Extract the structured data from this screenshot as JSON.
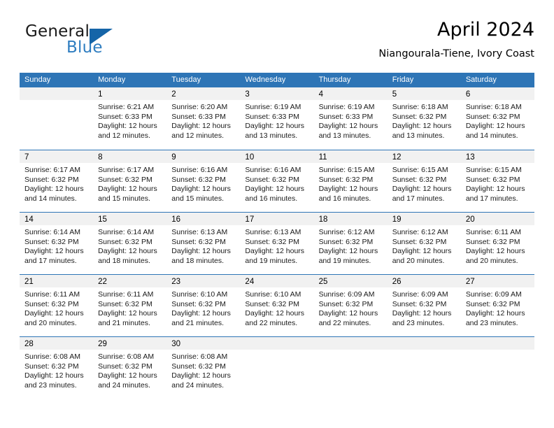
{
  "logo": {
    "word1": "General",
    "word2": "Blue",
    "triangle_icon": "blue-triangle-icon",
    "blue": "#2e7dc0",
    "triangle_color": "#1565a8"
  },
  "header": {
    "title": "April 2024",
    "subtitle": "Niangourala-Tiene, Ivory Coast"
  },
  "colors": {
    "header_blue": "#2e75b6",
    "week_divider": "#2e75b6",
    "daynum_band": "#f1f1f1",
    "text": "#000000"
  },
  "weekdays": [
    "Sunday",
    "Monday",
    "Tuesday",
    "Wednesday",
    "Thursday",
    "Friday",
    "Saturday"
  ],
  "weeks": [
    [
      {
        "day": ""
      },
      {
        "day": "1",
        "sunrise": "Sunrise: 6:21 AM",
        "sunset": "Sunset: 6:33 PM",
        "daylight1": "Daylight: 12 hours",
        "daylight2": "and 12 minutes."
      },
      {
        "day": "2",
        "sunrise": "Sunrise: 6:20 AM",
        "sunset": "Sunset: 6:33 PM",
        "daylight1": "Daylight: 12 hours",
        "daylight2": "and 12 minutes."
      },
      {
        "day": "3",
        "sunrise": "Sunrise: 6:19 AM",
        "sunset": "Sunset: 6:33 PM",
        "daylight1": "Daylight: 12 hours",
        "daylight2": "and 13 minutes."
      },
      {
        "day": "4",
        "sunrise": "Sunrise: 6:19 AM",
        "sunset": "Sunset: 6:33 PM",
        "daylight1": "Daylight: 12 hours",
        "daylight2": "and 13 minutes."
      },
      {
        "day": "5",
        "sunrise": "Sunrise: 6:18 AM",
        "sunset": "Sunset: 6:32 PM",
        "daylight1": "Daylight: 12 hours",
        "daylight2": "and 13 minutes."
      },
      {
        "day": "6",
        "sunrise": "Sunrise: 6:18 AM",
        "sunset": "Sunset: 6:32 PM",
        "daylight1": "Daylight: 12 hours",
        "daylight2": "and 14 minutes."
      }
    ],
    [
      {
        "day": "7",
        "sunrise": "Sunrise: 6:17 AM",
        "sunset": "Sunset: 6:32 PM",
        "daylight1": "Daylight: 12 hours",
        "daylight2": "and 14 minutes."
      },
      {
        "day": "8",
        "sunrise": "Sunrise: 6:17 AM",
        "sunset": "Sunset: 6:32 PM",
        "daylight1": "Daylight: 12 hours",
        "daylight2": "and 15 minutes."
      },
      {
        "day": "9",
        "sunrise": "Sunrise: 6:16 AM",
        "sunset": "Sunset: 6:32 PM",
        "daylight1": "Daylight: 12 hours",
        "daylight2": "and 15 minutes."
      },
      {
        "day": "10",
        "sunrise": "Sunrise: 6:16 AM",
        "sunset": "Sunset: 6:32 PM",
        "daylight1": "Daylight: 12 hours",
        "daylight2": "and 16 minutes."
      },
      {
        "day": "11",
        "sunrise": "Sunrise: 6:15 AM",
        "sunset": "Sunset: 6:32 PM",
        "daylight1": "Daylight: 12 hours",
        "daylight2": "and 16 minutes."
      },
      {
        "day": "12",
        "sunrise": "Sunrise: 6:15 AM",
        "sunset": "Sunset: 6:32 PM",
        "daylight1": "Daylight: 12 hours",
        "daylight2": "and 17 minutes."
      },
      {
        "day": "13",
        "sunrise": "Sunrise: 6:15 AM",
        "sunset": "Sunset: 6:32 PM",
        "daylight1": "Daylight: 12 hours",
        "daylight2": "and 17 minutes."
      }
    ],
    [
      {
        "day": "14",
        "sunrise": "Sunrise: 6:14 AM",
        "sunset": "Sunset: 6:32 PM",
        "daylight1": "Daylight: 12 hours",
        "daylight2": "and 17 minutes."
      },
      {
        "day": "15",
        "sunrise": "Sunrise: 6:14 AM",
        "sunset": "Sunset: 6:32 PM",
        "daylight1": "Daylight: 12 hours",
        "daylight2": "and 18 minutes."
      },
      {
        "day": "16",
        "sunrise": "Sunrise: 6:13 AM",
        "sunset": "Sunset: 6:32 PM",
        "daylight1": "Daylight: 12 hours",
        "daylight2": "and 18 minutes."
      },
      {
        "day": "17",
        "sunrise": "Sunrise: 6:13 AM",
        "sunset": "Sunset: 6:32 PM",
        "daylight1": "Daylight: 12 hours",
        "daylight2": "and 19 minutes."
      },
      {
        "day": "18",
        "sunrise": "Sunrise: 6:12 AM",
        "sunset": "Sunset: 6:32 PM",
        "daylight1": "Daylight: 12 hours",
        "daylight2": "and 19 minutes."
      },
      {
        "day": "19",
        "sunrise": "Sunrise: 6:12 AM",
        "sunset": "Sunset: 6:32 PM",
        "daylight1": "Daylight: 12 hours",
        "daylight2": "and 20 minutes."
      },
      {
        "day": "20",
        "sunrise": "Sunrise: 6:11 AM",
        "sunset": "Sunset: 6:32 PM",
        "daylight1": "Daylight: 12 hours",
        "daylight2": "and 20 minutes."
      }
    ],
    [
      {
        "day": "21",
        "sunrise": "Sunrise: 6:11 AM",
        "sunset": "Sunset: 6:32 PM",
        "daylight1": "Daylight: 12 hours",
        "daylight2": "and 20 minutes."
      },
      {
        "day": "22",
        "sunrise": "Sunrise: 6:11 AM",
        "sunset": "Sunset: 6:32 PM",
        "daylight1": "Daylight: 12 hours",
        "daylight2": "and 21 minutes."
      },
      {
        "day": "23",
        "sunrise": "Sunrise: 6:10 AM",
        "sunset": "Sunset: 6:32 PM",
        "daylight1": "Daylight: 12 hours",
        "daylight2": "and 21 minutes."
      },
      {
        "day": "24",
        "sunrise": "Sunrise: 6:10 AM",
        "sunset": "Sunset: 6:32 PM",
        "daylight1": "Daylight: 12 hours",
        "daylight2": "and 22 minutes."
      },
      {
        "day": "25",
        "sunrise": "Sunrise: 6:09 AM",
        "sunset": "Sunset: 6:32 PM",
        "daylight1": "Daylight: 12 hours",
        "daylight2": "and 22 minutes."
      },
      {
        "day": "26",
        "sunrise": "Sunrise: 6:09 AM",
        "sunset": "Sunset: 6:32 PM",
        "daylight1": "Daylight: 12 hours",
        "daylight2": "and 23 minutes."
      },
      {
        "day": "27",
        "sunrise": "Sunrise: 6:09 AM",
        "sunset": "Sunset: 6:32 PM",
        "daylight1": "Daylight: 12 hours",
        "daylight2": "and 23 minutes."
      }
    ],
    [
      {
        "day": "28",
        "sunrise": "Sunrise: 6:08 AM",
        "sunset": "Sunset: 6:32 PM",
        "daylight1": "Daylight: 12 hours",
        "daylight2": "and 23 minutes."
      },
      {
        "day": "29",
        "sunrise": "Sunrise: 6:08 AM",
        "sunset": "Sunset: 6:32 PM",
        "daylight1": "Daylight: 12 hours",
        "daylight2": "and 24 minutes."
      },
      {
        "day": "30",
        "sunrise": "Sunrise: 6:08 AM",
        "sunset": "Sunset: 6:32 PM",
        "daylight1": "Daylight: 12 hours",
        "daylight2": "and 24 minutes."
      },
      {
        "day": ""
      },
      {
        "day": ""
      },
      {
        "day": ""
      },
      {
        "day": ""
      }
    ]
  ]
}
